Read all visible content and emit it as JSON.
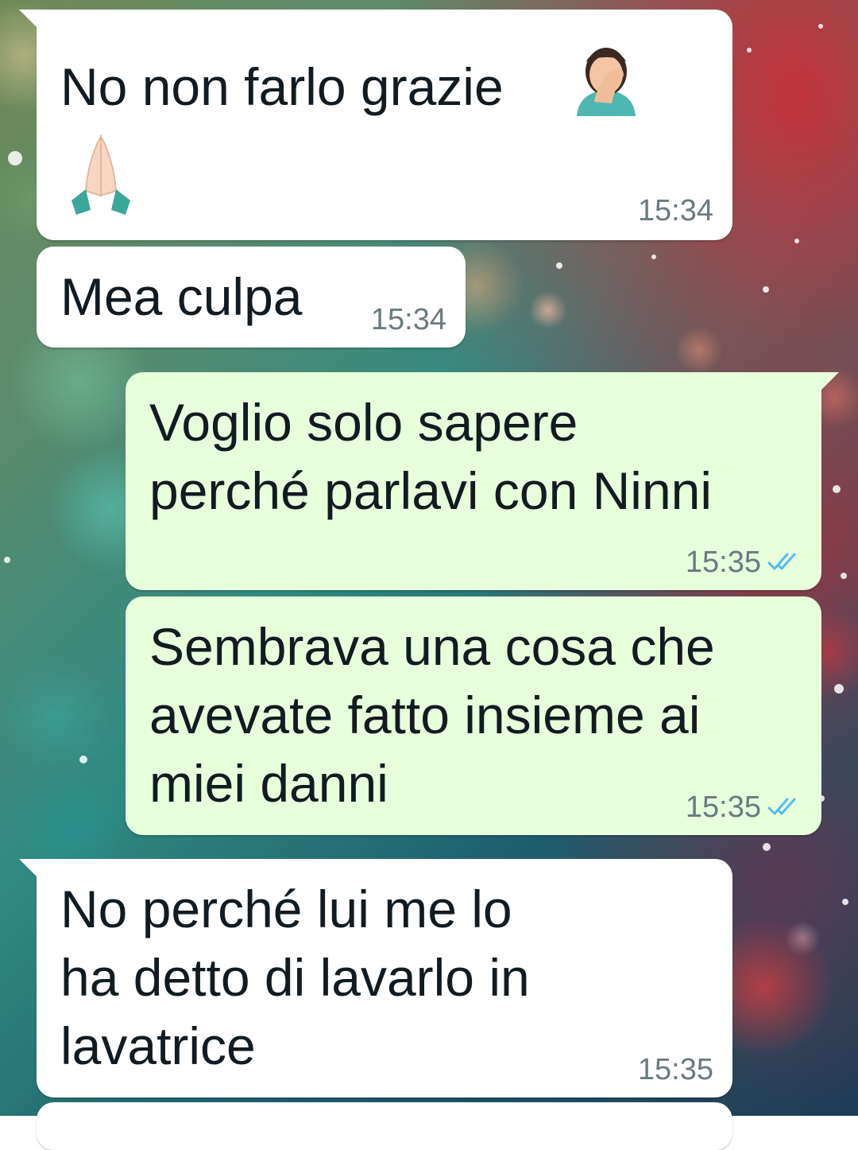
{
  "messages": [
    {
      "direction": "incoming",
      "text": "No non farlo grazie",
      "emojis": [
        "face-palm-emoji",
        "folded-hands-emoji"
      ],
      "time": "15:34"
    },
    {
      "direction": "incoming",
      "text": "Mea culpa",
      "time": "15:34"
    },
    {
      "direction": "outgoing",
      "text": "Voglio solo sapere\nperché parlavi con Ninni",
      "time": "15:35",
      "status": "read"
    },
    {
      "direction": "outgoing",
      "text": "Sembrava una cosa che\navevate fatto insieme ai\nmiei danni",
      "time": "15:35",
      "status": "read"
    },
    {
      "direction": "incoming",
      "text": "No perché lui me lo\nha detto di lavarlo in\nlavatrice",
      "time": "15:35"
    }
  ],
  "colors": {
    "incoming_bubble": "#ffffff",
    "outgoing_bubble": "#e7ffdb",
    "read_tick": "#53bdeb",
    "timestamp": "#6b7a80"
  }
}
